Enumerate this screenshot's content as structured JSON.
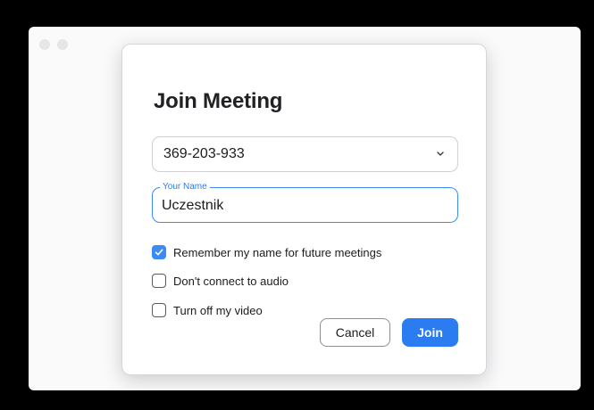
{
  "dialog": {
    "title": "Join Meeting",
    "meeting_id": {
      "value": "369-203-933",
      "icon": "chevron-down-icon"
    },
    "name_field": {
      "label": "Your Name",
      "value": "Uczestnik"
    },
    "options": [
      {
        "label": "Remember my name for future meetings",
        "checked": true
      },
      {
        "label": "Don't connect to audio",
        "checked": false
      },
      {
        "label": "Turn off my video",
        "checked": false
      }
    ],
    "buttons": {
      "cancel": "Cancel",
      "join": "Join"
    }
  },
  "colors": {
    "accent": "#2b7cf0",
    "background": "#000000",
    "window": "#fafafb"
  }
}
